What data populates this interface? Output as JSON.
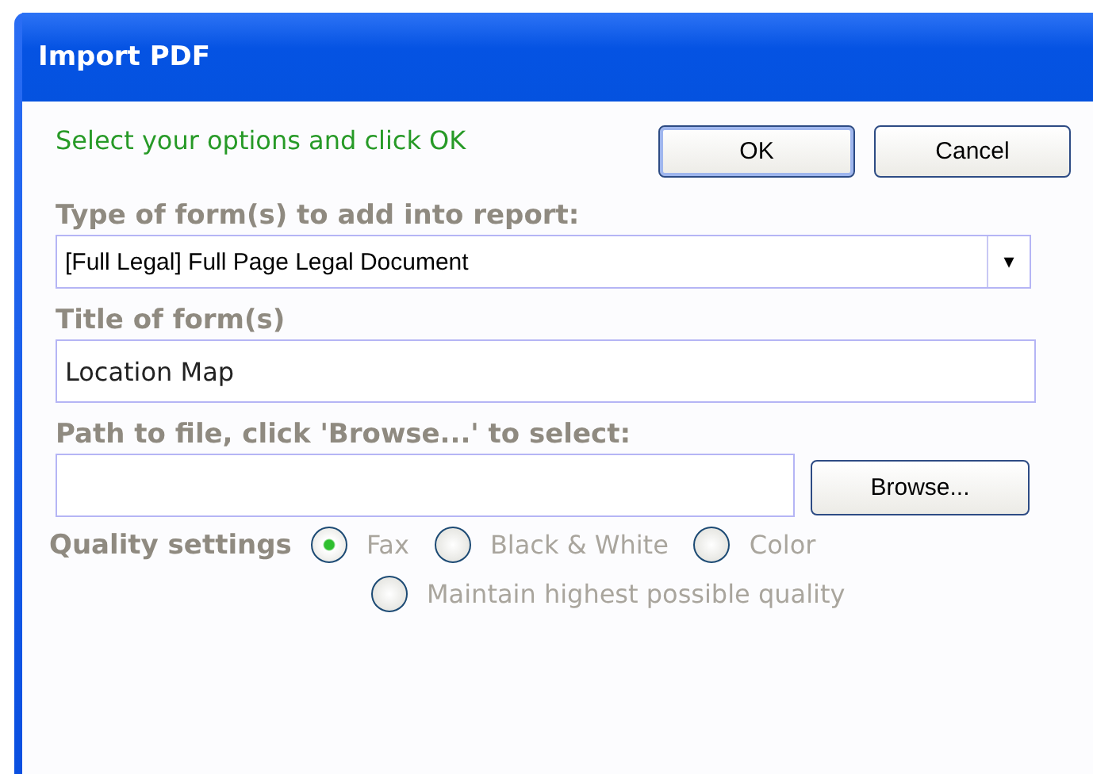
{
  "window": {
    "title": "Import PDF"
  },
  "instruction": "Select your options and click OK",
  "buttons": [
    {
      "label": "OK",
      "default": true
    },
    {
      "label": "Cancel",
      "default": false
    }
  ],
  "form_type": {
    "label": "Type of form(s) to add into report:",
    "value": "[Full Legal] Full Page Legal Document",
    "arrow": "▾"
  },
  "form_title": {
    "label": "Title of form(s)",
    "value": "Location Map"
  },
  "path": {
    "label": "Path to file, click 'Browse...' to select:",
    "button": "Browse..."
  },
  "quality": {
    "label": "Quality settings",
    "options": [
      {
        "label": "Fax",
        "selected": true
      },
      {
        "label": "Black & White",
        "selected": false
      },
      {
        "label": "Color",
        "selected": false
      },
      {
        "label": "Maintain highest possible quality",
        "selected": false
      }
    ]
  }
}
